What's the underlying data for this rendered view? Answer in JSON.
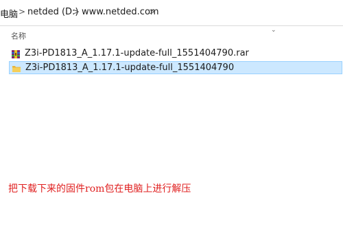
{
  "address_bar": {
    "crumbs": [
      "电脑",
      "netded (D:)",
      "www.netded.com"
    ],
    "separator": ">",
    "chevron_icon": "chevron-down-icon"
  },
  "list_header": {
    "name_label": "名称",
    "sort_icon": "chevron-down-icon"
  },
  "files": [
    {
      "name": "Z3i-PD1813_A_1.17.1-update-full_1551404790.rar",
      "icon": "archive-icon",
      "selected": false
    },
    {
      "name": "Z3i-PD1813_A_1.17.1-update-full_1551404790",
      "icon": "folder-icon",
      "selected": true
    }
  ],
  "annotation": {
    "text": "把下载下来的固件rom包在电脑上进行解压",
    "color": "#e02020"
  },
  "colors": {
    "selection_bg": "#cce8ff",
    "selection_border": "#99d1ff"
  }
}
